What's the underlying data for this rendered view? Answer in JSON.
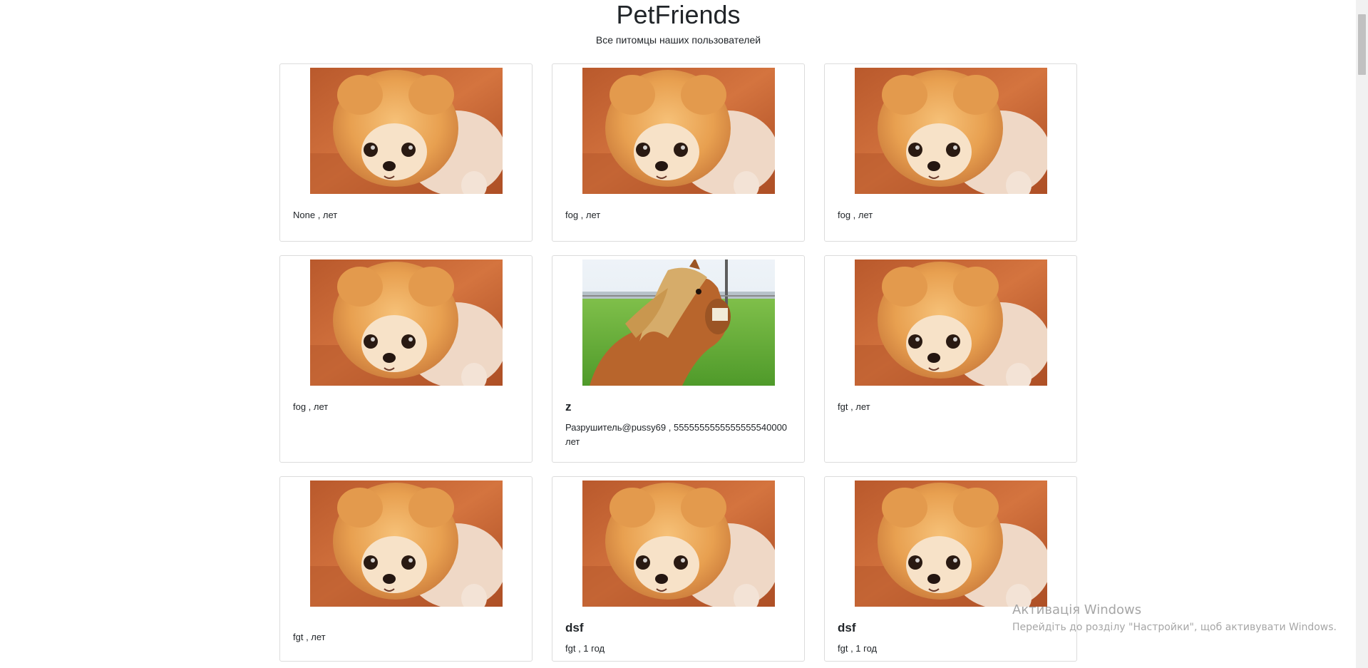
{
  "header": {
    "title": "PetFriends",
    "subtitle": "Все питомцы наших пользователей"
  },
  "pets": [
    {
      "photo": "pomeranian-photo",
      "name": "",
      "info": "None , лет"
    },
    {
      "photo": "pomeranian-photo",
      "name": "",
      "info": "fog , лет"
    },
    {
      "photo": "pomeranian-photo",
      "name": "",
      "info": "fog , лет"
    },
    {
      "photo": "pomeranian-photo",
      "name": "",
      "info": "fog , лет"
    },
    {
      "photo": "horse-photo",
      "name": "z",
      "info": "Разрушитель@pussy69 , 5555555555555555540000 лет"
    },
    {
      "photo": "pomeranian-photo",
      "name": "",
      "info": "fgt , лет"
    },
    {
      "photo": "pomeranian-photo",
      "name": "",
      "info": "fgt , лет"
    },
    {
      "photo": "pomeranian-photo",
      "name": "dsf",
      "info": "fgt , 1 год"
    },
    {
      "photo": "pomeranian-photo",
      "name": "dsf",
      "info": "fgt , 1 год"
    }
  ],
  "watermark": {
    "title": "Активація Windows",
    "text": "Перейдіть до розділу \"Настройки\", щоб активувати Windows."
  },
  "colors": {
    "card_border": "#dcdcdc",
    "text": "#212529",
    "watermark": "#a6a6a6"
  }
}
